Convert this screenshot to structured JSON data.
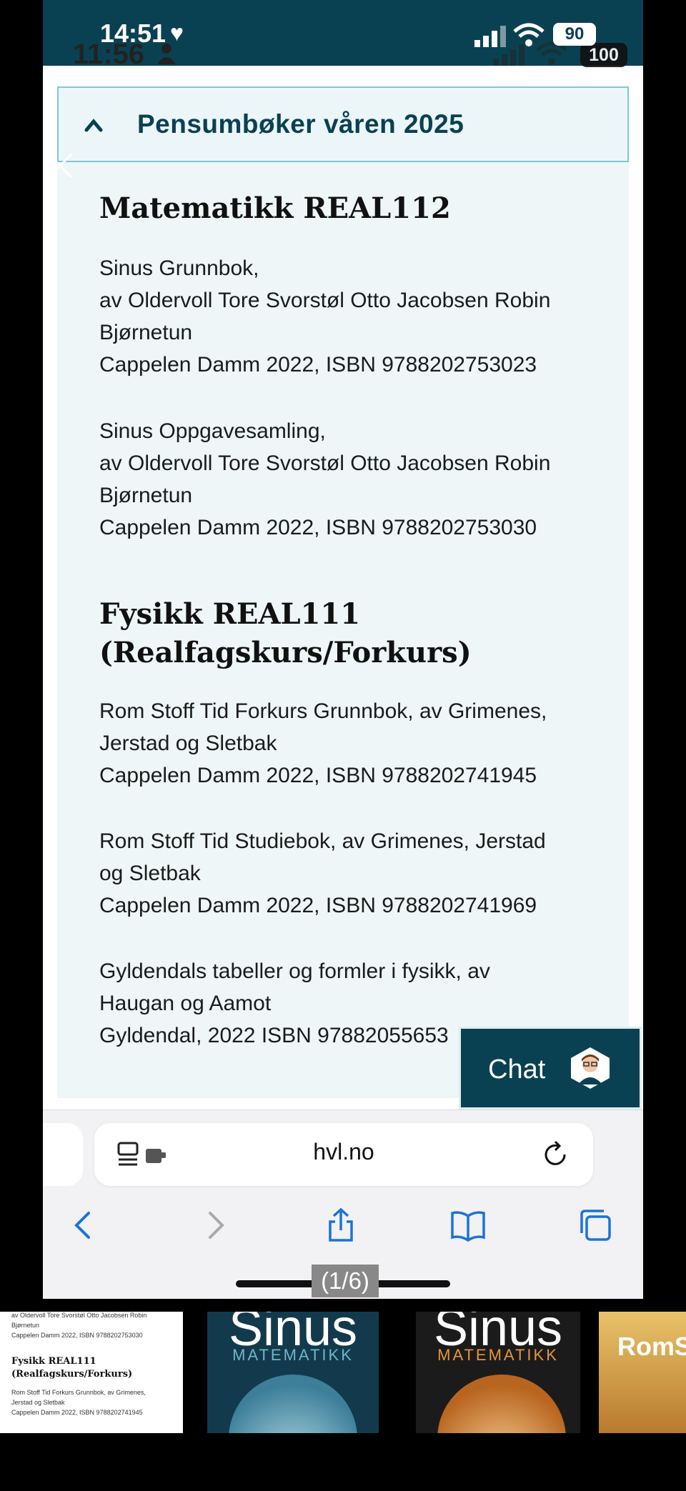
{
  "status_bar": {
    "time": "14:51",
    "time_ghost": "11:56",
    "battery": "90",
    "battery_ghost": "100"
  },
  "accordion": {
    "title": "Pensumbøker våren 2025"
  },
  "sections": [
    {
      "heading": "Matematikk REAL112",
      "books": [
        [
          "Sinus Grunnbok,",
          "av Oldervoll Tore Svorstøl Otto Jacobsen Robin",
          "Bjørnetun",
          "Cappelen Damm 2022, ISBN 9788202753023"
        ],
        [
          "Sinus Oppgavesamling,",
          "av Oldervoll Tore Svorstøl Otto Jacobsen Robin",
          "Bjørnetun",
          "Cappelen Damm 2022, ISBN 9788202753030"
        ]
      ]
    },
    {
      "heading_lines": [
        "Fysikk REAL111",
        "(Realfagskurs/Forkurs)"
      ],
      "books": [
        [
          "Rom Stoff Tid Forkurs Grunnbok, av Grimenes,",
          "Jerstad og Sletbak",
          "Cappelen Damm 2022, ISBN 9788202741945"
        ],
        [
          "Rom Stoff Tid Studiebok, av Grimenes, Jerstad",
          "og Sletbak",
          "Cappelen Damm 2022, ISBN 9788202741969"
        ],
        [
          "Gyldendals tabeller og formler i fysikk, av",
          "Haugan og Aamot",
          "Gyldendal, 2022 ISBN 97882055653"
        ]
      ]
    }
  ],
  "chat": {
    "label": "Chat"
  },
  "browser": {
    "url": "hvl.no"
  },
  "viewer": {
    "page_counter": "(1/6)"
  },
  "thumbnails": {
    "doc_lines": [
      "av Oldervoll Tore Svorstøl Otto Jacobsen Robin",
      "Bjørnetun",
      "Cappelen Damm 2022, ISBN 9788202753030"
    ],
    "doc_heading": [
      "Fysikk REAL111",
      "(Realfagskurs/Forkurs)"
    ],
    "doc_lines2": [
      "Rom Stoff Tid Forkurs Grunnbok, av Grimenes,",
      "Jerstad og Sletbak",
      "Cappelen Damm 2022, ISBN 9788202741945"
    ],
    "cover1_title": "Sinus",
    "cover1_sub": "MATEMATIKK",
    "cover2_title": "Sinus",
    "cover2_sub": "MATEMATIKK",
    "cover3_title": "RomS"
  },
  "colors": {
    "brand_dark": "#0a4152",
    "accordion_bg": "#eef6f7",
    "accordion_border": "#7ec8d0",
    "link_blue": "#1a73d9"
  }
}
